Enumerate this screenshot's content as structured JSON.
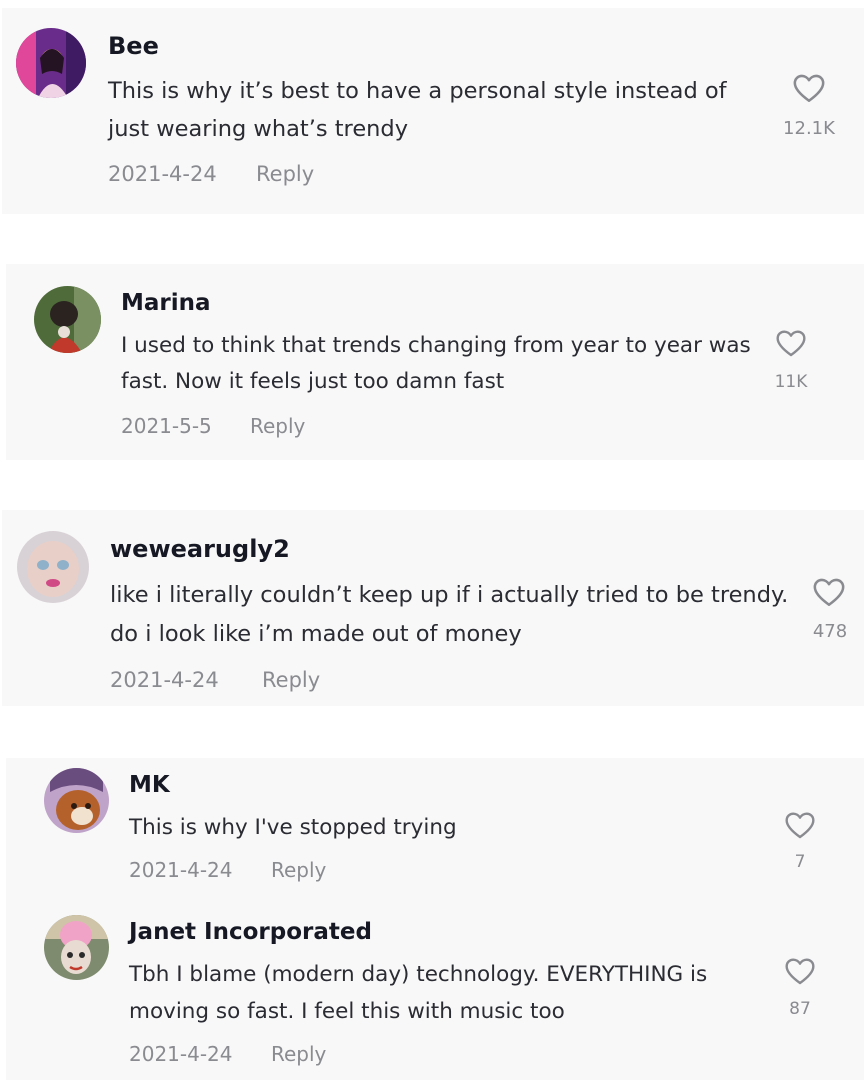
{
  "comments": [
    {
      "name": "Bee",
      "text": "This is why it’s best to have a personal style instead of just wearing what’s trendy",
      "date": "2021-4-24",
      "reply": "Reply",
      "likes": "12.1K"
    },
    {
      "name": "Marina",
      "text": "I used to think that trends changing from year to year was fast. Now it feels just too damn fast",
      "date": "2021-5-5",
      "reply": "Reply",
      "likes": "11K"
    },
    {
      "name": "wewearugly2",
      "text": "like i literally couldn’t keep up if i actually tried to be trendy. do i look like i’m made out of money",
      "date": "2021-4-24",
      "reply": "Reply",
      "likes": "478"
    },
    {
      "name": "MK",
      "text": "This is why I've stopped trying",
      "date": "2021-4-24",
      "reply": "Reply",
      "likes": "7"
    },
    {
      "name": "Janet Incorporated",
      "text": "Tbh I blame (modern day) technology. EVERYTHING is moving so fast. I feel this with music too",
      "date": "2021-4-24",
      "reply": "Reply",
      "likes": "87"
    }
  ],
  "icons": {
    "like": "heart-outline-icon",
    "avatar": "user-avatar"
  }
}
